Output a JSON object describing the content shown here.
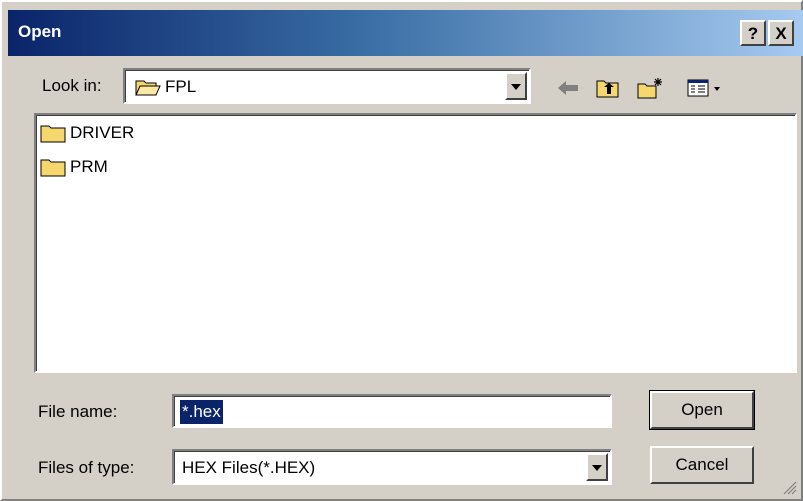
{
  "window": {
    "title": "Open",
    "help_label": "?",
    "close_label": "X"
  },
  "lookin": {
    "label": "Look in:",
    "value": "FPL"
  },
  "toolbar": {
    "icons": [
      "back-arrow-icon",
      "up-folder-icon",
      "new-folder-icon",
      "view-menu-icon"
    ]
  },
  "files": [
    {
      "name": "DRIVER",
      "type": "folder"
    },
    {
      "name": "PRM",
      "type": "folder"
    }
  ],
  "filename": {
    "label": "File name:",
    "value": "*.hex"
  },
  "filetype": {
    "label": "Files of type:",
    "value": "HEX Files(*.HEX)"
  },
  "buttons": {
    "open": "Open",
    "cancel": "Cancel"
  },
  "colors": {
    "titlebar_start": "#0a246a",
    "titlebar_end": "#a6caf0",
    "dialog_bg": "#d4d0c8",
    "selection": "#0a246a",
    "folder": "#f5d76e"
  }
}
